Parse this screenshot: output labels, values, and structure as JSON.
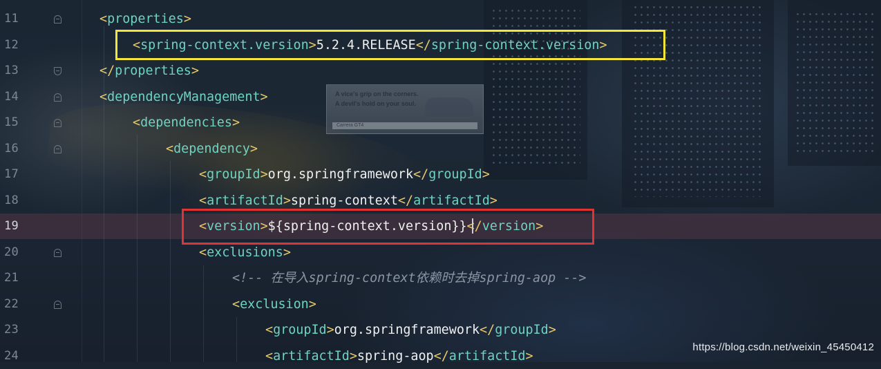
{
  "editor": {
    "lines": [
      {
        "number": "11",
        "fold": "close",
        "indent": 1,
        "tokens": [
          [
            "tag",
            "<"
          ],
          [
            "name",
            "properties"
          ],
          [
            "tag",
            ">"
          ]
        ]
      },
      {
        "number": "12",
        "fold": "",
        "indent": 2,
        "tokens": [
          [
            "tag",
            "<"
          ],
          [
            "name",
            "spring-context.version"
          ],
          [
            "tag",
            ">"
          ],
          [
            "txt",
            "5.2.4.RELEASE"
          ],
          [
            "tag",
            "</"
          ],
          [
            "name",
            "spring-context.version"
          ],
          [
            "tag",
            ">"
          ]
        ]
      },
      {
        "number": "13",
        "fold": "open",
        "indent": 1,
        "tokens": [
          [
            "tag",
            "</"
          ],
          [
            "name",
            "properties"
          ],
          [
            "tag",
            ">"
          ]
        ]
      },
      {
        "number": "14",
        "fold": "close",
        "indent": 1,
        "tokens": [
          [
            "tag",
            "<"
          ],
          [
            "name",
            "dependencyManagement"
          ],
          [
            "tag",
            ">"
          ]
        ]
      },
      {
        "number": "15",
        "fold": "close",
        "indent": 2,
        "tokens": [
          [
            "tag",
            "<"
          ],
          [
            "name",
            "dependencies"
          ],
          [
            "tag",
            ">"
          ]
        ]
      },
      {
        "number": "16",
        "fold": "close",
        "indent": 3,
        "tokens": [
          [
            "tag",
            "<"
          ],
          [
            "name",
            "dependency"
          ],
          [
            "tag",
            ">"
          ]
        ]
      },
      {
        "number": "17",
        "fold": "",
        "indent": 4,
        "tokens": [
          [
            "tag",
            "<"
          ],
          [
            "name",
            "groupId"
          ],
          [
            "tag",
            ">"
          ],
          [
            "txt",
            "org.springframework"
          ],
          [
            "tag",
            "</"
          ],
          [
            "name",
            "groupId"
          ],
          [
            "tag",
            ">"
          ]
        ]
      },
      {
        "number": "18",
        "fold": "",
        "indent": 4,
        "tokens": [
          [
            "tag",
            "<"
          ],
          [
            "name",
            "artifactId"
          ],
          [
            "tag",
            ">"
          ],
          [
            "txt",
            "spring-context"
          ],
          [
            "tag",
            "</"
          ],
          [
            "name",
            "artifactId"
          ],
          [
            "tag",
            ">"
          ]
        ]
      },
      {
        "number": "19",
        "fold": "",
        "indent": 4,
        "current": true,
        "tokens": [
          [
            "tag",
            "<"
          ],
          [
            "name",
            "version"
          ],
          [
            "tag",
            ">"
          ],
          [
            "txt",
            "${spring-context.version}}"
          ],
          [
            "tag",
            "</"
          ],
          [
            "name",
            "version"
          ],
          [
            "tag",
            ">"
          ]
        ]
      },
      {
        "number": "20",
        "fold": "close",
        "indent": 4,
        "tokens": [
          [
            "tag",
            "<"
          ],
          [
            "name",
            "exclusions"
          ],
          [
            "tag",
            ">"
          ]
        ]
      },
      {
        "number": "21",
        "fold": "",
        "indent": 5,
        "tokens": [
          [
            "cmt",
            "<!-- 在导入spring-context依赖时去掉spring-aop -->"
          ]
        ]
      },
      {
        "number": "22",
        "fold": "close",
        "indent": 5,
        "tokens": [
          [
            "tag",
            "<"
          ],
          [
            "name",
            "exclusion"
          ],
          [
            "tag",
            ">"
          ]
        ]
      },
      {
        "number": "23",
        "fold": "",
        "indent": 6,
        "tokens": [
          [
            "tag",
            "<"
          ],
          [
            "name",
            "groupId"
          ],
          [
            "tag",
            ">"
          ],
          [
            "txt",
            "org.springframework"
          ],
          [
            "tag",
            "</"
          ],
          [
            "name",
            "groupId"
          ],
          [
            "tag",
            ">"
          ]
        ]
      },
      {
        "number": "24",
        "fold": "",
        "indent": 6,
        "tokens": [
          [
            "tag",
            "<"
          ],
          [
            "name",
            "artifactId"
          ],
          [
            "tag",
            ">"
          ],
          [
            "txt",
            "spring-aop"
          ],
          [
            "tag",
            "</"
          ],
          [
            "name",
            "artifactId"
          ],
          [
            "tag",
            ">"
          ]
        ]
      }
    ]
  },
  "billboard": {
    "headline_1": "A vice's grip on the corners.",
    "headline_2": "A devil's hold on your soul.",
    "model": "Carrera GT4"
  },
  "watermark": "https://blog.csdn.net/weixin_45450412",
  "colors": {
    "tag_bracket": "#e6c96b",
    "tag_name": "#6fd3c1",
    "text": "#f0f0f0",
    "comment": "#8b95a3",
    "highlight_yellow": "#f3e53a",
    "highlight_red": "#e03434",
    "current_line": "#6e3c4b"
  },
  "icons": {
    "fold_marker": "fold-marker-icon"
  }
}
